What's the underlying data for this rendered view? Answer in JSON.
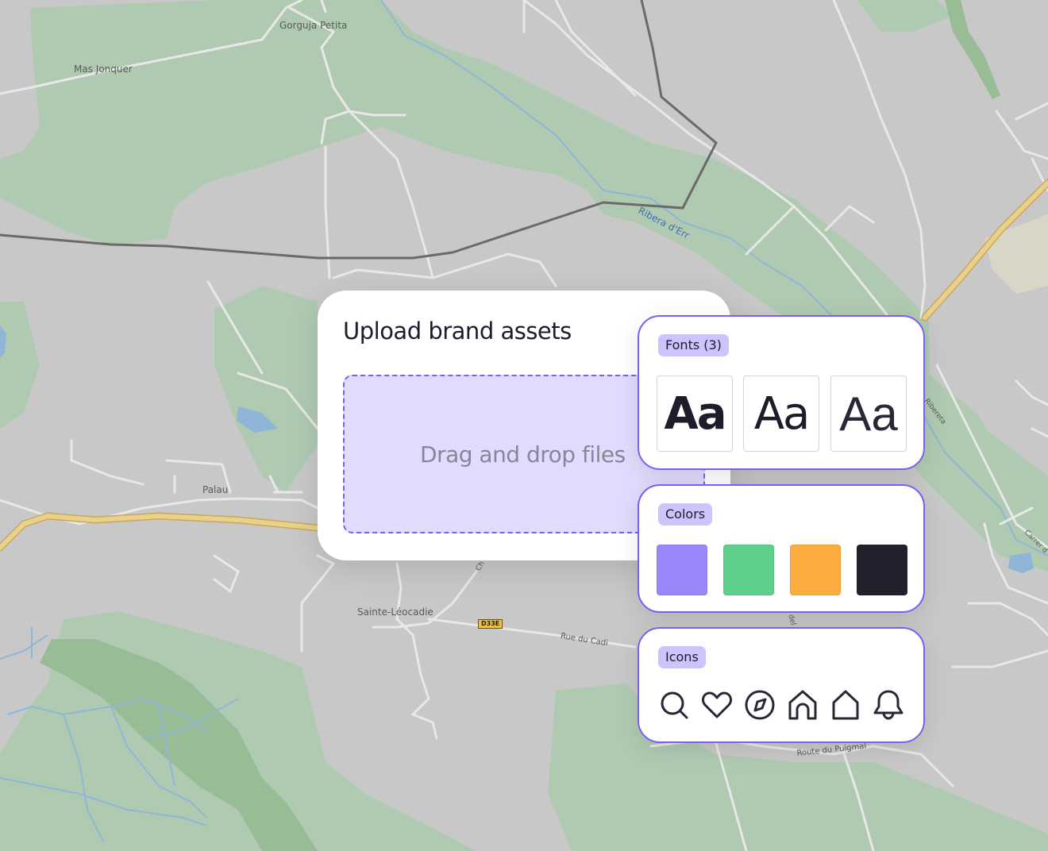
{
  "map": {
    "labels": {
      "gorguja_petita": "Gorguja Petita",
      "mas_jonquer": "Mas Jonquer",
      "ribera_derr": "Ribera d'Err",
      "palau": "Palau",
      "sainte_leocadie": "Sainte-Léocadie",
      "rue_du_cadi": "Rue du Cadi",
      "route_du_puigmal": "Route du Puigmal",
      "la_ribereta": "la Ribereta",
      "carrer": "Carrer d",
      "chemin_fragment": "Ch",
      "del_fragment": "del C"
    },
    "road_shield": "D33E"
  },
  "upload": {
    "title": "Upload brand assets",
    "dropzone_text": "Drag and drop files"
  },
  "fonts": {
    "label": "Fonts (3)",
    "samples": [
      {
        "text": "Aa",
        "weight": "bold"
      },
      {
        "text": "Aa",
        "weight": "regular"
      },
      {
        "text": "Aa",
        "weight": "light"
      }
    ]
  },
  "colors": {
    "label": "Colors",
    "swatches": [
      "#9b87fb",
      "#5fd08b",
      "#fdac40",
      "#23202d"
    ]
  },
  "icons": {
    "label": "Icons",
    "items": [
      "search-icon",
      "heart-icon",
      "compass-icon",
      "home-icon",
      "house-outline-icon",
      "bell-icon"
    ]
  }
}
